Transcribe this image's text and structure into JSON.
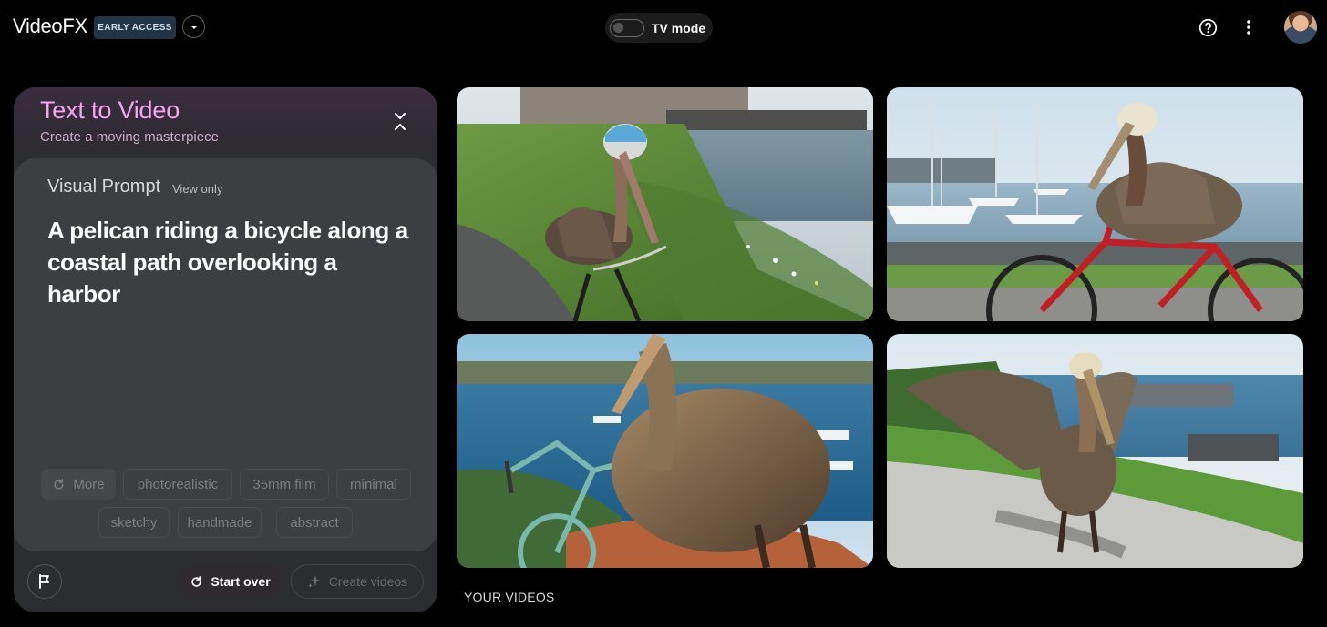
{
  "app": {
    "name": "VideoFX",
    "badge": "EARLY ACCESS"
  },
  "header": {
    "tv_mode_label": "TV mode",
    "tv_mode_on": false,
    "icons": [
      "chevron-down-icon",
      "help-icon",
      "more-vert-icon",
      "avatar"
    ]
  },
  "panel": {
    "title": "Text to Video",
    "subtitle": "Create a moving masterpiece",
    "prompt_header": "Visual Prompt",
    "prompt_mode": "View only",
    "prompt_text": "A pelican riding a bicycle along a coastal path overlooking a harbor",
    "chips": {
      "more": "More",
      "photorealistic": "photorealistic",
      "film": "35mm film",
      "minimal": "minimal",
      "sketchy": "sketchy",
      "handmade": "handmade",
      "abstract": "abstract"
    },
    "start_over": "Start over",
    "create_videos": "Create videos"
  },
  "videos": {
    "section_label": "YOUR VIDEOS",
    "count": 4
  },
  "colors": {
    "accent_title": "#f4a6f0",
    "panel_bg": "#2c2d30",
    "card_bg": "#3d3e41",
    "badge_bg": "#243447"
  }
}
